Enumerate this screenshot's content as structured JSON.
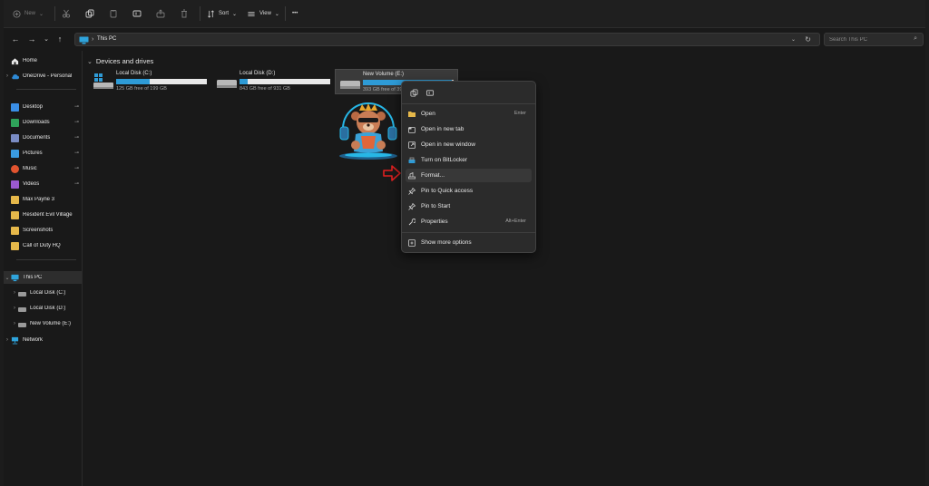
{
  "toolbar": {
    "new_label": "New",
    "sort_label": "Sort",
    "view_label": "View",
    "more_label": "•••"
  },
  "address": {
    "path": "This PC",
    "search_placeholder": "Search This PC"
  },
  "sidebar": {
    "home": "Home",
    "onedrive": "OneDrive - Personal",
    "quick": [
      {
        "label": "Desktop",
        "color": "#3a8ee6"
      },
      {
        "label": "Downloads",
        "color": "#2fa35a"
      },
      {
        "label": "Documents",
        "color": "#7a8cc4"
      },
      {
        "label": "Pictures",
        "color": "#3a9be0"
      },
      {
        "label": "Music",
        "color": "#e2542f"
      },
      {
        "label": "Videos",
        "color": "#9b59d0"
      }
    ],
    "folders": [
      "Max Payne 3",
      "Resident Evil Village",
      "Screenshots",
      "Call of Duty HQ"
    ],
    "this_pc": "This PC",
    "drives": [
      "Local Disk (C:)",
      "Local Disk (D:)",
      "New Volume (E:)"
    ],
    "network": "Network"
  },
  "content": {
    "section_title": "Devices and drives",
    "drives": [
      {
        "name": "Local Disk (C:)",
        "free": "125 GB free of 199 GB",
        "used_fraction": 0.37
      },
      {
        "name": "Local Disk (D:)",
        "free": "843 GB free of 931 GB",
        "used_fraction": 0.09
      },
      {
        "name": "New Volume (E:)",
        "free": "393 GB free of 393 GB",
        "used_fraction": 0.98
      }
    ]
  },
  "context_menu": {
    "items": [
      {
        "label": "Open",
        "shortcut": "Enter",
        "icon": "folder-icon"
      },
      {
        "label": "Open in new tab",
        "shortcut": "",
        "icon": "new-tab-icon"
      },
      {
        "label": "Open in new window",
        "shortcut": "",
        "icon": "new-window-icon"
      },
      {
        "label": "Turn on BitLocker",
        "shortcut": "",
        "icon": "key-icon"
      },
      {
        "label": "Format...",
        "shortcut": "",
        "icon": "format-icon"
      },
      {
        "label": "Pin to Quick access",
        "shortcut": "",
        "icon": "pin-icon"
      },
      {
        "label": "Pin to Start",
        "shortcut": "",
        "icon": "pin-icon"
      },
      {
        "label": "Properties",
        "shortcut": "Alt+Enter",
        "icon": "wrench-icon"
      }
    ],
    "more": "Show more options"
  },
  "colors": {
    "accent": "#2e9bd6",
    "annotation_arrow": "#e02020"
  }
}
